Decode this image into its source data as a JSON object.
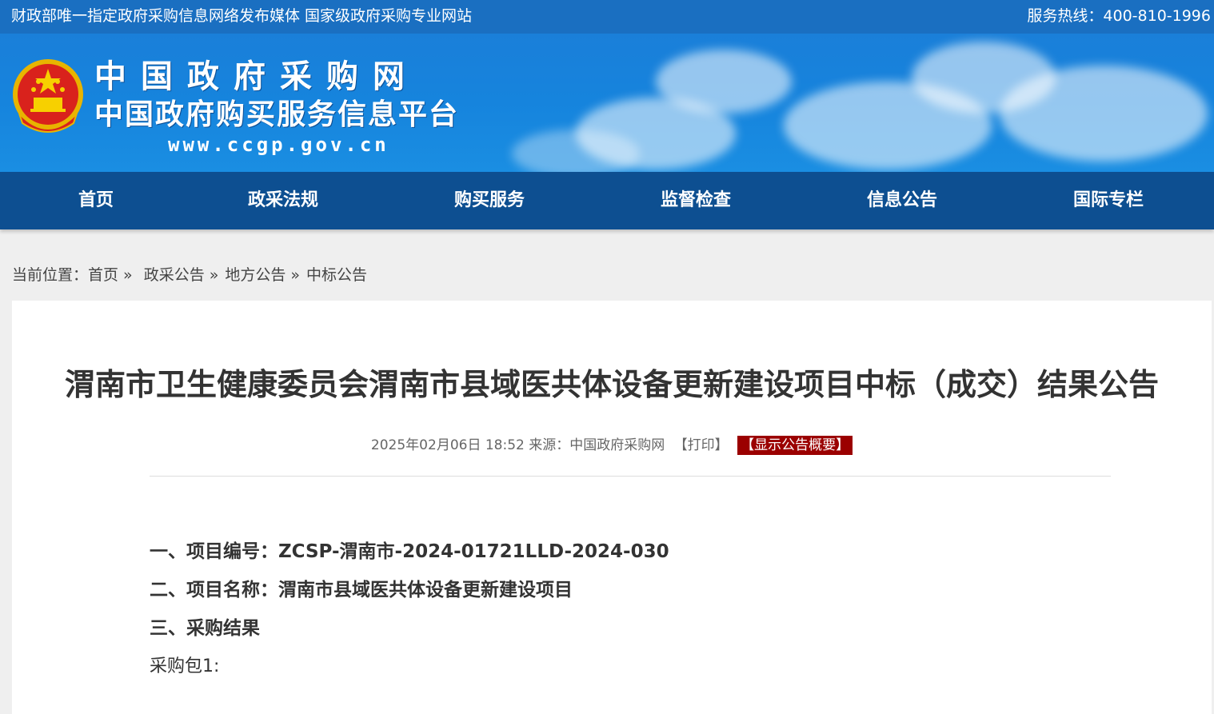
{
  "topbar": {
    "slogan": "财政部唯一指定政府采购信息网络发布媒体 国家级政府采购专业网站",
    "hotline": "服务热线：400-810-1996"
  },
  "banner": {
    "title": "中国政府采购网",
    "subtitle": "中国政府购买服务信息平台",
    "url": "www.ccgp.gov.cn",
    "emblem_icon": "national-emblem-icon"
  },
  "nav": {
    "items": [
      {
        "label": "首页"
      },
      {
        "label": "政采法规"
      },
      {
        "label": "购买服务"
      },
      {
        "label": "监督检查"
      },
      {
        "label": "信息公告"
      },
      {
        "label": "国际专栏"
      }
    ]
  },
  "breadcrumb": {
    "prefix": "当前位置：",
    "items": [
      "首页",
      "政采公告",
      "地方公告",
      "中标公告"
    ],
    "separator": "»"
  },
  "article": {
    "title": "渭南市卫生健康委员会渭南市县域医共体设备更新建设项目中标（成交）结果公告",
    "datetime": "2025年02月06日 18:52",
    "source_label": "来源：",
    "source": "中国政府采购网",
    "print_label": "【打印】",
    "summary_label": "【显示公告概要】",
    "sections": [
      "一、项目编号：ZCSP-渭南市-2024-01721LLD-2024-030",
      "二、项目名称：渭南市县域医共体设备更新建设项目",
      "三、采购结果"
    ],
    "package_label": "采购包1:"
  },
  "colors": {
    "topbar": "#1a6fc1",
    "nav": "#0d4f91",
    "summary_button": "#9b0000"
  }
}
